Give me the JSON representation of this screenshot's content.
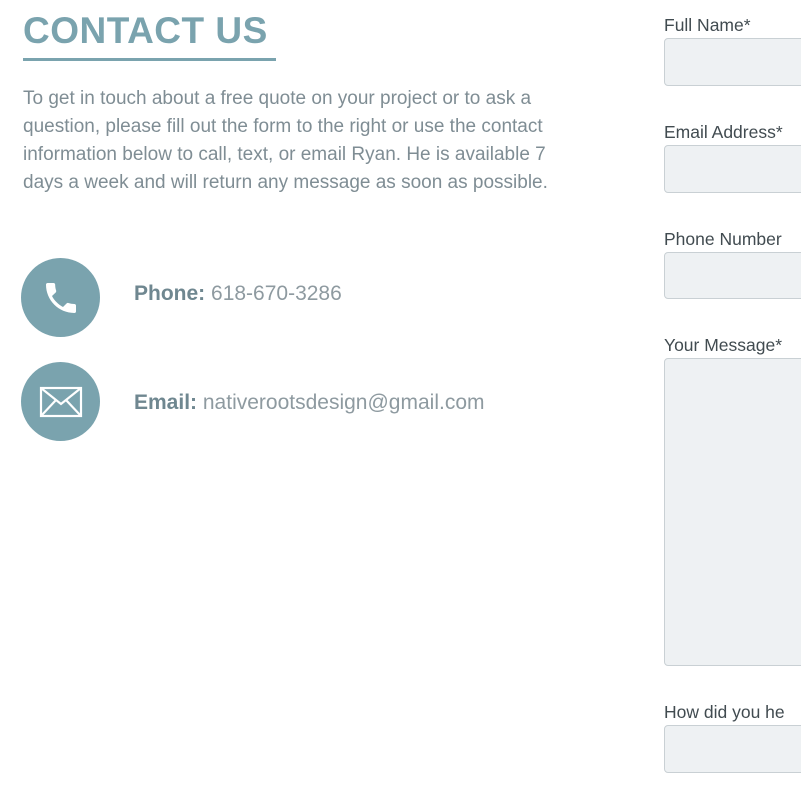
{
  "heading": "CONTACT US",
  "intro": "To get in touch about a free quote on your project or to ask a question, please fill out the form to the right or use the contact information below to call, text, or email Ryan. He is available 7 days a week and will return any message as soon as possible.",
  "contacts": {
    "phone": {
      "label": "Phone:",
      "value": "618-670-3286",
      "icon": "phone-icon"
    },
    "email": {
      "label": "Email:",
      "value": "nativerootsdesign@gmail.com",
      "icon": "envelope-icon"
    }
  },
  "form": {
    "full_name": {
      "label": "Full Name*",
      "value": ""
    },
    "email": {
      "label": "Email Address*",
      "value": ""
    },
    "phone": {
      "label": "Phone Number",
      "value": ""
    },
    "message": {
      "label": "Your Message*",
      "value": ""
    },
    "referral": {
      "label": "How did you he",
      "value": ""
    }
  },
  "colors": {
    "accent": "#7aa3ae",
    "text_muted": "#7f8d94",
    "field_bg": "#eef1f3"
  }
}
